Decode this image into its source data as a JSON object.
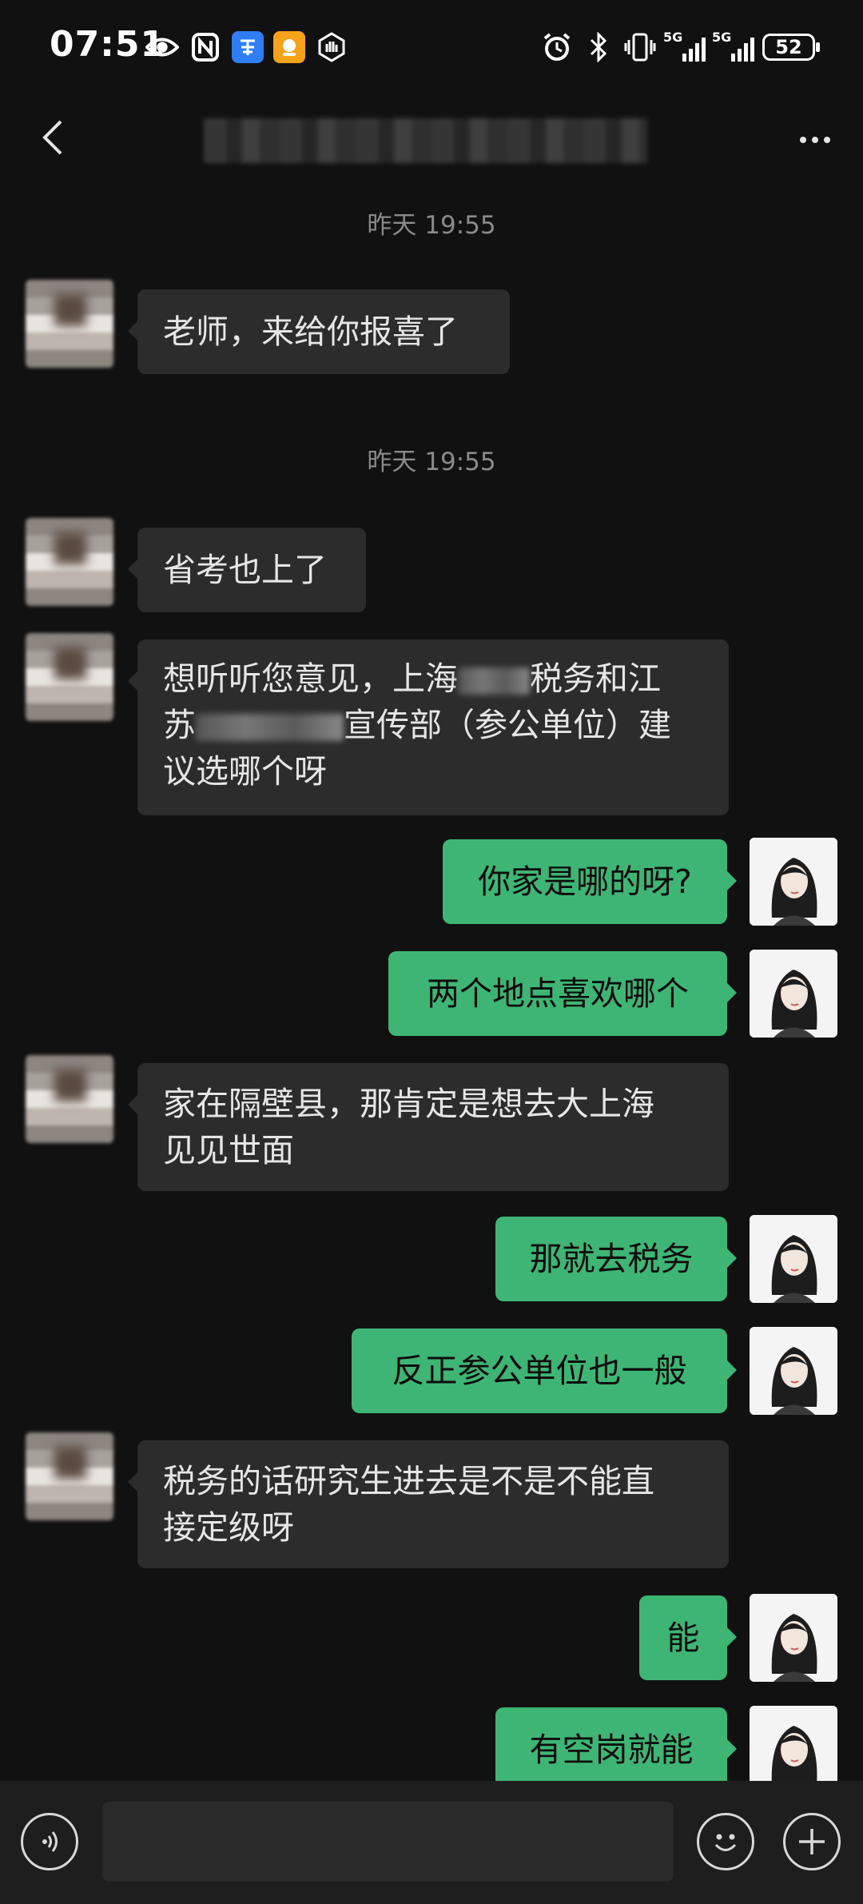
{
  "status_bar": {
    "time": "07:51",
    "battery": "52",
    "network_1": "5G",
    "network_2": "5G",
    "left_icons": [
      "eye-icon",
      "nfc-icon",
      "app-badge-icon",
      "app-badge-icon",
      "shield-hand-icon"
    ],
    "right_icons": [
      "alarm-icon",
      "bluetooth-icon",
      "vibrate-icon",
      "signal-icon",
      "signal-icon",
      "battery-icon"
    ]
  },
  "header": {
    "title": "",
    "back_icon": "chevron-left-icon",
    "more_icon": "more-dots-icon"
  },
  "messages": [
    {
      "type": "timestamp",
      "text": "昨天 19:55"
    },
    {
      "type": "received",
      "text": "老师，来给你报喜了"
    },
    {
      "type": "timestamp",
      "text": "昨天 19:55"
    },
    {
      "type": "received",
      "text": "省考也上了"
    },
    {
      "type": "received",
      "line1_a": "想听听您意见，上海",
      "line1_b": "税务和江",
      "line2_a": "苏",
      "line2_b": "宣传部（参公单位）建",
      "line3": "议选哪个呀"
    },
    {
      "type": "sent",
      "text": "你家是哪的呀?"
    },
    {
      "type": "sent",
      "text": "两个地点喜欢哪个"
    },
    {
      "type": "received",
      "line1": "家在隔壁县，那肯定是想去大上海",
      "line2": "见见世面"
    },
    {
      "type": "sent",
      "text": "那就去税务"
    },
    {
      "type": "sent",
      "text": "反正参公单位也一般"
    },
    {
      "type": "received",
      "line1": "税务的话研究生进去是不是不能直",
      "line2": "接定级呀"
    },
    {
      "type": "sent",
      "text": "能"
    },
    {
      "type": "sent",
      "text": "有空岗就能"
    }
  ],
  "input_bar": {
    "voice_icon": "voice-icon",
    "text_value": "",
    "emoji_icon": "emoji-icon",
    "plus_icon": "plus-icon"
  },
  "colors": {
    "background": "#111111",
    "received_bubble": "#2c2c2c",
    "sent_bubble": "#3eb575",
    "timestamp": "#8a8a8a"
  }
}
